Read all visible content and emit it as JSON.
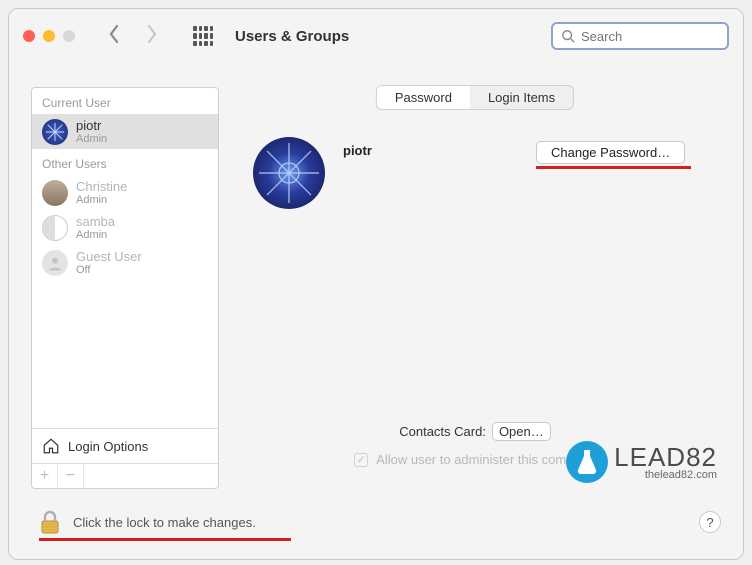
{
  "toolbar": {
    "title": "Users & Groups",
    "search_placeholder": "Search"
  },
  "sidebar": {
    "current_header": "Current User",
    "other_header": "Other Users",
    "login_options": "Login Options",
    "users": [
      {
        "name": "piotr",
        "role": "Admin"
      },
      {
        "name": "Christine",
        "role": "Admin"
      },
      {
        "name": "samba",
        "role": "Admin"
      },
      {
        "name": "Guest User",
        "role": "Off"
      }
    ]
  },
  "tabs": {
    "password": "Password",
    "login_items": "Login Items"
  },
  "main": {
    "username": "piotr",
    "change_password": "Change Password…",
    "contacts_label": "Contacts Card:",
    "open_btn": "Open…",
    "admin_checkbox": "Allow user to administer this computer"
  },
  "footer": {
    "lock_text": "Click the lock to make changes.",
    "help": "?"
  },
  "watermark": {
    "brand": "LEAD82",
    "url": "thelead82.com"
  }
}
